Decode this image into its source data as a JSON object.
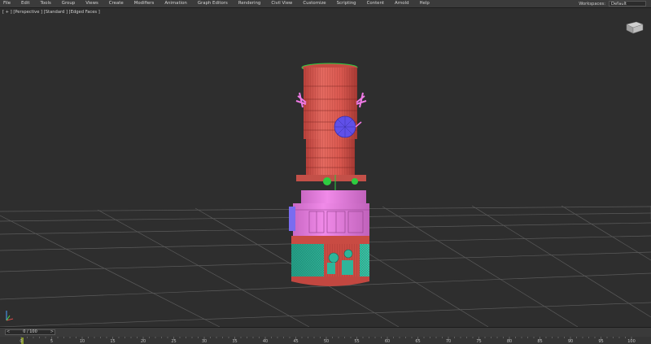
{
  "menu": {
    "items": [
      "File",
      "Edit",
      "Tools",
      "Group",
      "Views",
      "Create",
      "Modifiers",
      "Animation",
      "Graph Editors",
      "Rendering",
      "Civil View",
      "Customize",
      "Scripting",
      "Content",
      "Arnold",
      "Help"
    ]
  },
  "workspace": {
    "label": "Workspaces:",
    "value": "Default"
  },
  "viewport": {
    "label": "[ + ] [Perspective ] [Standard ] [Edged Faces ]"
  },
  "timeline": {
    "slider_value": "0 / 100",
    "prev_glyph": "<",
    "next_glyph": ">",
    "ruler_labels": [
      "0",
      "5",
      "10",
      "15",
      "20",
      "25",
      "30",
      "35",
      "40",
      "45",
      "50",
      "55",
      "60",
      "65",
      "70",
      "75",
      "80",
      "85",
      "90",
      "95",
      "100"
    ]
  },
  "colors": {
    "body_red": "#d9584f",
    "band_pink": "#e77ee0",
    "panel_teal": "#2fb59a",
    "dish_blue": "#6050e8",
    "accent_green": "#2ecc40",
    "grid": "#555555"
  },
  "icons": {
    "viewcube": "viewcube-icon",
    "axis": "axis-gizmo-icon"
  }
}
